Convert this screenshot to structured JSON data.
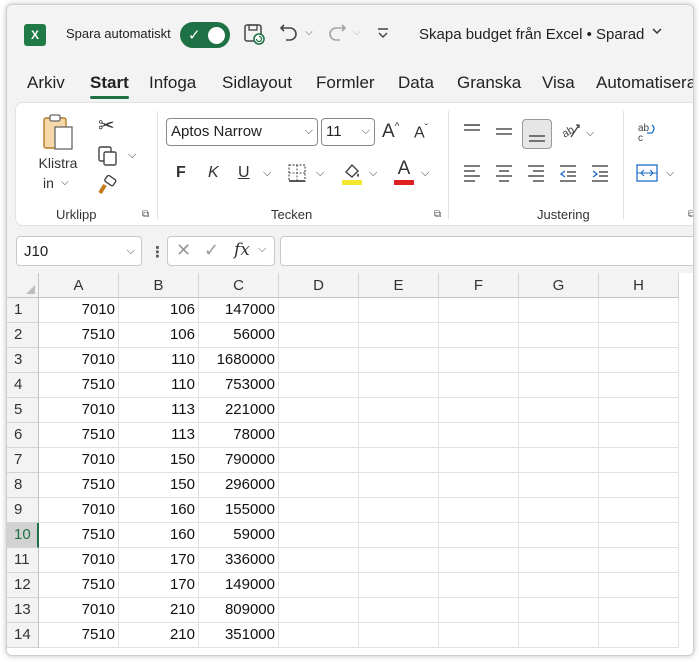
{
  "title_bar": {
    "app_logo": "X",
    "autosave_label": "Spara automatiskt",
    "autosave_on": true,
    "document_title": "Skapa budget från Excel • Sparad"
  },
  "tabs": [
    "Arkiv",
    "Start",
    "Infoga",
    "Sidlayout",
    "Formler",
    "Data",
    "Granska",
    "Visa",
    "Automatisera"
  ],
  "active_tab": "Start",
  "ribbon": {
    "clipboard": {
      "paste_label_line1": "Klistra",
      "paste_label_line2": "in",
      "group_label": "Urklipp"
    },
    "font": {
      "font_name": "Aptos Narrow",
      "font_size": "11",
      "bold": "F",
      "italic": "K",
      "underline": "U",
      "font_color_glyph": "A",
      "grow_glyph": "A",
      "shrink_glyph": "A",
      "highlight_color": "#f5e62f",
      "font_color": "#e02020",
      "group_label": "Tecken"
    },
    "alignment": {
      "group_label": "Justering"
    }
  },
  "formula_bar": {
    "cell_reference": "J10",
    "fx": "fx",
    "formula": ""
  },
  "sheet": {
    "columns": [
      "A",
      "B",
      "C",
      "D",
      "E",
      "F",
      "G",
      "H"
    ],
    "selected_row": 10,
    "rows": [
      {
        "num": "1",
        "a": "7010",
        "b": "106",
        "c": "147000"
      },
      {
        "num": "2",
        "a": "7510",
        "b": "106",
        "c": "56000"
      },
      {
        "num": "3",
        "a": "7010",
        "b": "110",
        "c": "1680000"
      },
      {
        "num": "4",
        "a": "7510",
        "b": "110",
        "c": "753000"
      },
      {
        "num": "5",
        "a": "7010",
        "b": "113",
        "c": "221000"
      },
      {
        "num": "6",
        "a": "7510",
        "b": "113",
        "c": "78000"
      },
      {
        "num": "7",
        "a": "7010",
        "b": "150",
        "c": "790000"
      },
      {
        "num": "8",
        "a": "7510",
        "b": "150",
        "c": "296000"
      },
      {
        "num": "9",
        "a": "7010",
        "b": "160",
        "c": "155000"
      },
      {
        "num": "10",
        "a": "7510",
        "b": "160",
        "c": "59000"
      },
      {
        "num": "11",
        "a": "7010",
        "b": "170",
        "c": "336000"
      },
      {
        "num": "12",
        "a": "7510",
        "b": "170",
        "c": "149000"
      },
      {
        "num": "13",
        "a": "7010",
        "b": "210",
        "c": "809000"
      },
      {
        "num": "14",
        "a": "7510",
        "b": "210",
        "c": "351000"
      }
    ]
  },
  "colors": {
    "accent_green": "#1e7145",
    "excel_green": "#1f7a45"
  }
}
